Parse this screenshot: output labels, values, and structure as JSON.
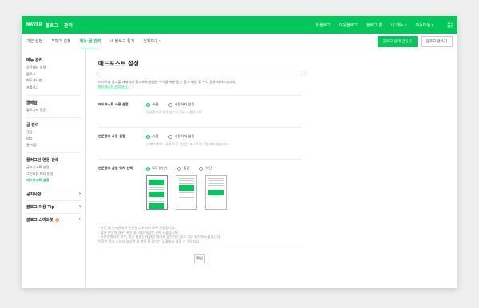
{
  "app": {
    "logo": "NAVER",
    "title": "블로그 · 관리"
  },
  "topnav": [
    "내 블로그",
    "이웃블로그",
    "블로그 홈",
    "내 메뉴 ▾",
    "아웃미싱 ▾"
  ],
  "tabs": [
    "기본 설정",
    "꾸미기 설정",
    "메뉴·글·관리",
    "내 블로그 통계",
    "전체보기 ▾"
  ],
  "buttons": {
    "make_blog": "블로그 쉽게 만들기",
    "write": "블로그 글쓰기",
    "confirm": "확인"
  },
  "sidebar": {
    "sections": [
      {
        "title": "메뉴 관리",
        "items": [
          "상단메뉴 설정",
          "블로그",
          "메모게시판",
          "프롤로그"
        ]
      },
      {
        "title": "글배달",
        "items": [
          "블로그씨 질문"
        ]
      },
      {
        "title": "글 관리",
        "items": [
          "댓글",
          "태그",
          "글 저장"
        ]
      },
      {
        "title": "플러그인·연동 관리",
        "items": [
          "글쓰기 API 설정",
          "그린리뷰 배너 설정",
          "애드포스트 설정"
        ]
      }
    ],
    "menus": [
      "공지사항",
      "블로그 이용 Tip",
      "블로그 스마트봇 🔥"
    ]
  },
  "content": {
    "title": "애드포스트 설정",
    "desc": "미디어에 광고를 게재하고 광고에서 발생한 수익을 배분 받는 광고 매칭 및 수익 공유 서비스입니다.",
    "link": "애드포스트 관리하기 ›",
    "rows": [
      {
        "label": "애드포스트 사용 설정",
        "opt1": "사용",
        "opt2": "사용하지 않음",
        "hint": "혹은광고와 본문광고가 모두 노출됩니다."
      },
      {
        "label": "본문광고 사용 설정",
        "opt1": "사용",
        "opt2": "사용하지 않음",
        "hint": "스마트에디터 2.0 으로 작성한 포스트에 적용되지 않습니다."
      },
      {
        "label": "본문광고 삽입 위치 선택",
        "opts": [
          "모두(기본)",
          "중간",
          "하단"
        ]
      }
    ],
    "notes": [
      "- 본문 내 판매문서와 본문광고 위치가 모두 변경됩니다.",
      "- 짧은 본문의 경우, 본문 중 가장 적합한 곳에 노출됩니다.",
      "- 모바일에서의 경우, 최근 활동상과 환경 따라서 일반적인 광고 일부 위치에 노출됩니다.",
      "  적합한 광고 소재가 없다면 위 항목 중 광고는 노출되지 않을 수 있습니다."
    ]
  }
}
